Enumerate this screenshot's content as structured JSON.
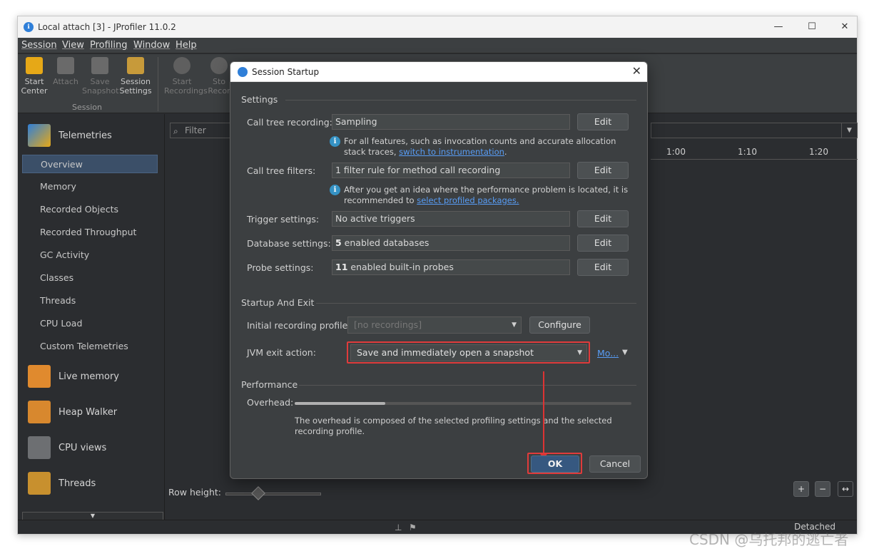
{
  "window": {
    "title": "Local attach [3] - JProfiler 11.0.2",
    "controls": {
      "minimize": "—",
      "maximize": "☐",
      "close": "✕"
    }
  },
  "menu": [
    "Session",
    "View",
    "Profiling",
    "Window",
    "Help"
  ],
  "toolbar": {
    "buttons": [
      {
        "line1": "Start",
        "line2": "Center"
      },
      {
        "line1": "Attach",
        "line2": ""
      },
      {
        "line1": "Save",
        "line2": "Snapshot"
      },
      {
        "line1": "Session",
        "line2": "Settings"
      },
      {
        "line1": "Start",
        "line2": "Recordings"
      },
      {
        "line1": "Sto",
        "line2": "Recor"
      }
    ],
    "group_label": "Session"
  },
  "sidebar": {
    "telemetries": "Telemetries",
    "items": [
      "Overview",
      "Memory",
      "Recorded Objects",
      "Recorded Throughput",
      "GC Activity",
      "Classes",
      "Threads",
      "CPU Load",
      "Custom Telemetries"
    ],
    "sections": [
      "Live memory",
      "Heap Walker",
      "CPU views",
      "Threads"
    ]
  },
  "content": {
    "filter_placeholder": "Filter",
    "ticks": [
      "1:00",
      "1:10",
      "1:20"
    ],
    "row_height_label": "Row height:",
    "status_text": "Detached"
  },
  "dialog": {
    "title": "Session Startup",
    "settings_header": "Settings",
    "rows": [
      {
        "label": "Call tree recording:",
        "value": "Sampling",
        "bold": "",
        "button": "Edit"
      },
      {
        "label": "Call tree filters:",
        "value": "1 filter rule for method call recording",
        "bold": "",
        "button": "Edit"
      },
      {
        "label": "Trigger settings:",
        "value": "No active triggers",
        "bold": "",
        "button": "Edit"
      },
      {
        "label": "Database settings:",
        "value": " enabled databases",
        "bold": "5",
        "button": "Edit"
      },
      {
        "label": "Probe settings:",
        "value": " enabled built-in probes",
        "bold": "11",
        "button": "Edit"
      }
    ],
    "info1": {
      "text": "For all features, such as invocation counts and accurate allocation stack traces, ",
      "link": "switch to instrumentation",
      "after": "."
    },
    "info2": {
      "text": "After you get an idea where the performance problem is located, it is recommended to ",
      "link": "select profiled packages.",
      "after": ""
    },
    "startup_header": "Startup And Exit",
    "initial_profile_label": "Initial recording profile:",
    "initial_profile_value": "[no recordings]",
    "configure_button": "Configure",
    "jvm_exit_label": "JVM exit action:",
    "jvm_exit_value": "Save and immediately open a snapshot",
    "more_link": "Mo...",
    "performance_header": "Performance",
    "overhead_label": "Overhead:",
    "overhead_level": 0.27,
    "note": "The overhead is composed of the selected profiling settings and the selected recording profile.",
    "ok_button": "OK",
    "cancel_button": "Cancel"
  },
  "watermark": "CSDN @乌托邦的逃亡者",
  "colors": {
    "highlight": "#e03b3b",
    "link": "#589df6",
    "selection": "#3b4f68"
  }
}
